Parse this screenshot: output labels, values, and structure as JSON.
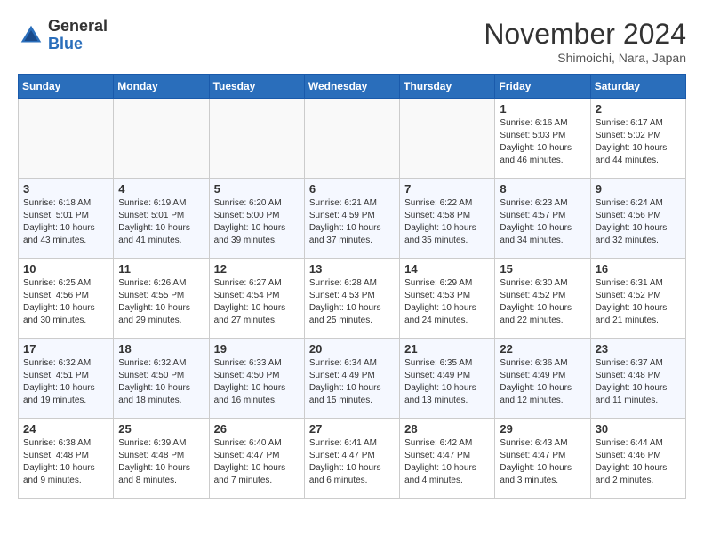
{
  "logo": {
    "general": "General",
    "blue": "Blue"
  },
  "header": {
    "month": "November 2024",
    "location": "Shimoichi, Nara, Japan"
  },
  "weekdays": [
    "Sunday",
    "Monday",
    "Tuesday",
    "Wednesday",
    "Thursday",
    "Friday",
    "Saturday"
  ],
  "weeks": [
    [
      {
        "day": "",
        "info": ""
      },
      {
        "day": "",
        "info": ""
      },
      {
        "day": "",
        "info": ""
      },
      {
        "day": "",
        "info": ""
      },
      {
        "day": "",
        "info": ""
      },
      {
        "day": "1",
        "info": "Sunrise: 6:16 AM\nSunset: 5:03 PM\nDaylight: 10 hours and 46 minutes."
      },
      {
        "day": "2",
        "info": "Sunrise: 6:17 AM\nSunset: 5:02 PM\nDaylight: 10 hours and 44 minutes."
      }
    ],
    [
      {
        "day": "3",
        "info": "Sunrise: 6:18 AM\nSunset: 5:01 PM\nDaylight: 10 hours and 43 minutes."
      },
      {
        "day": "4",
        "info": "Sunrise: 6:19 AM\nSunset: 5:01 PM\nDaylight: 10 hours and 41 minutes."
      },
      {
        "day": "5",
        "info": "Sunrise: 6:20 AM\nSunset: 5:00 PM\nDaylight: 10 hours and 39 minutes."
      },
      {
        "day": "6",
        "info": "Sunrise: 6:21 AM\nSunset: 4:59 PM\nDaylight: 10 hours and 37 minutes."
      },
      {
        "day": "7",
        "info": "Sunrise: 6:22 AM\nSunset: 4:58 PM\nDaylight: 10 hours and 35 minutes."
      },
      {
        "day": "8",
        "info": "Sunrise: 6:23 AM\nSunset: 4:57 PM\nDaylight: 10 hours and 34 minutes."
      },
      {
        "day": "9",
        "info": "Sunrise: 6:24 AM\nSunset: 4:56 PM\nDaylight: 10 hours and 32 minutes."
      }
    ],
    [
      {
        "day": "10",
        "info": "Sunrise: 6:25 AM\nSunset: 4:56 PM\nDaylight: 10 hours and 30 minutes."
      },
      {
        "day": "11",
        "info": "Sunrise: 6:26 AM\nSunset: 4:55 PM\nDaylight: 10 hours and 29 minutes."
      },
      {
        "day": "12",
        "info": "Sunrise: 6:27 AM\nSunset: 4:54 PM\nDaylight: 10 hours and 27 minutes."
      },
      {
        "day": "13",
        "info": "Sunrise: 6:28 AM\nSunset: 4:53 PM\nDaylight: 10 hours and 25 minutes."
      },
      {
        "day": "14",
        "info": "Sunrise: 6:29 AM\nSunset: 4:53 PM\nDaylight: 10 hours and 24 minutes."
      },
      {
        "day": "15",
        "info": "Sunrise: 6:30 AM\nSunset: 4:52 PM\nDaylight: 10 hours and 22 minutes."
      },
      {
        "day": "16",
        "info": "Sunrise: 6:31 AM\nSunset: 4:52 PM\nDaylight: 10 hours and 21 minutes."
      }
    ],
    [
      {
        "day": "17",
        "info": "Sunrise: 6:32 AM\nSunset: 4:51 PM\nDaylight: 10 hours and 19 minutes."
      },
      {
        "day": "18",
        "info": "Sunrise: 6:32 AM\nSunset: 4:50 PM\nDaylight: 10 hours and 18 minutes."
      },
      {
        "day": "19",
        "info": "Sunrise: 6:33 AM\nSunset: 4:50 PM\nDaylight: 10 hours and 16 minutes."
      },
      {
        "day": "20",
        "info": "Sunrise: 6:34 AM\nSunset: 4:49 PM\nDaylight: 10 hours and 15 minutes."
      },
      {
        "day": "21",
        "info": "Sunrise: 6:35 AM\nSunset: 4:49 PM\nDaylight: 10 hours and 13 minutes."
      },
      {
        "day": "22",
        "info": "Sunrise: 6:36 AM\nSunset: 4:49 PM\nDaylight: 10 hours and 12 minutes."
      },
      {
        "day": "23",
        "info": "Sunrise: 6:37 AM\nSunset: 4:48 PM\nDaylight: 10 hours and 11 minutes."
      }
    ],
    [
      {
        "day": "24",
        "info": "Sunrise: 6:38 AM\nSunset: 4:48 PM\nDaylight: 10 hours and 9 minutes."
      },
      {
        "day": "25",
        "info": "Sunrise: 6:39 AM\nSunset: 4:48 PM\nDaylight: 10 hours and 8 minutes."
      },
      {
        "day": "26",
        "info": "Sunrise: 6:40 AM\nSunset: 4:47 PM\nDaylight: 10 hours and 7 minutes."
      },
      {
        "day": "27",
        "info": "Sunrise: 6:41 AM\nSunset: 4:47 PM\nDaylight: 10 hours and 6 minutes."
      },
      {
        "day": "28",
        "info": "Sunrise: 6:42 AM\nSunset: 4:47 PM\nDaylight: 10 hours and 4 minutes."
      },
      {
        "day": "29",
        "info": "Sunrise: 6:43 AM\nSunset: 4:47 PM\nDaylight: 10 hours and 3 minutes."
      },
      {
        "day": "30",
        "info": "Sunrise: 6:44 AM\nSunset: 4:46 PM\nDaylight: 10 hours and 2 minutes."
      }
    ]
  ]
}
